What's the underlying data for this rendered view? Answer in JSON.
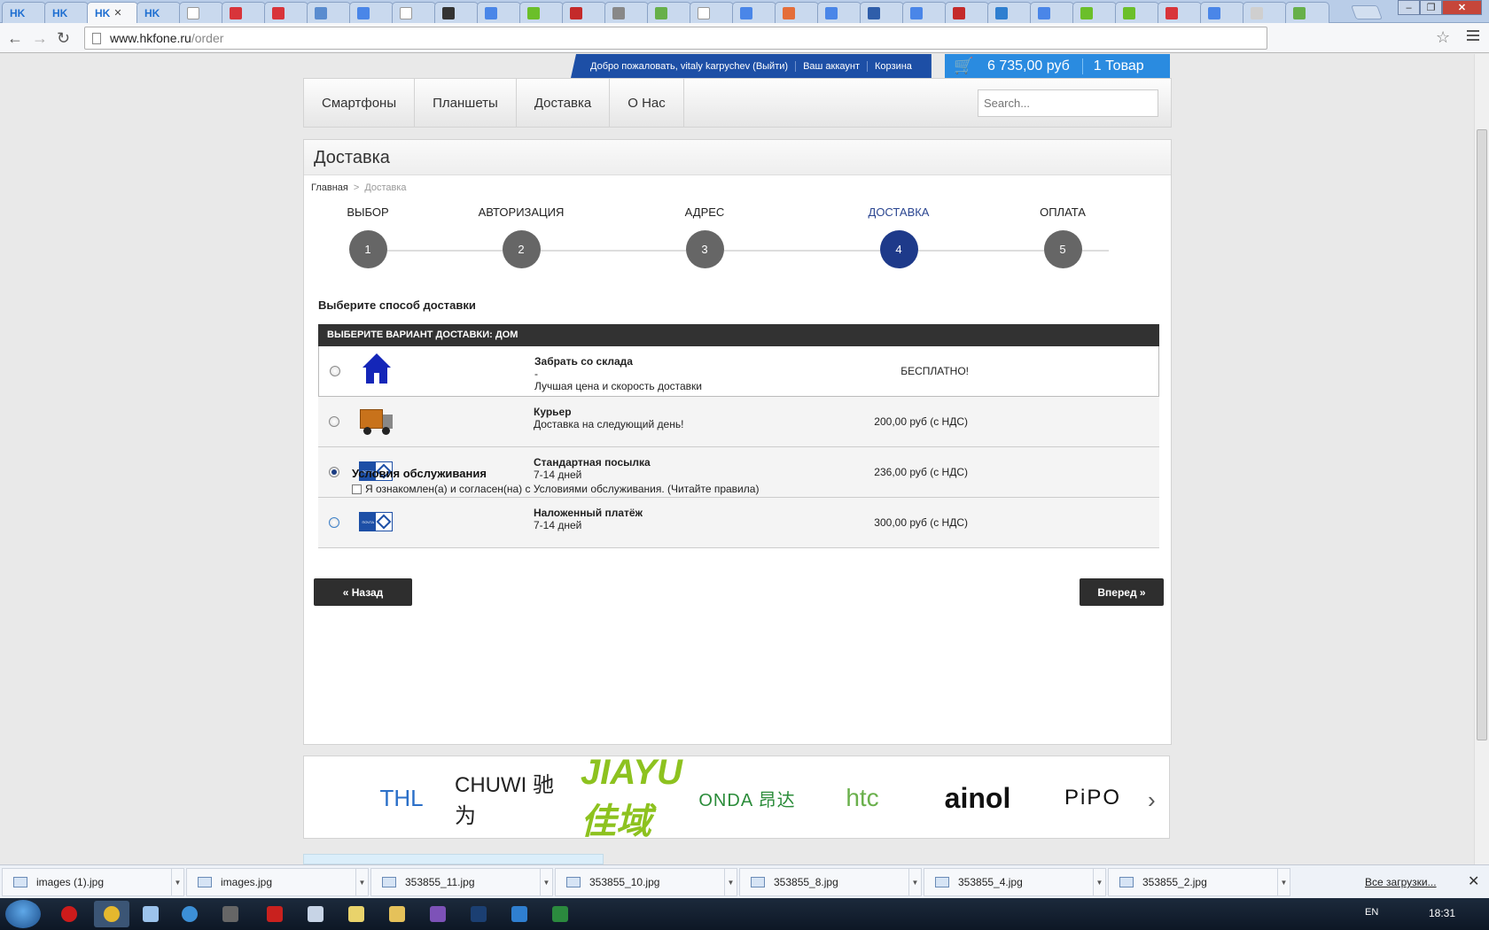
{
  "browser": {
    "tabs": [
      {
        "label": "HK",
        "active": false
      },
      {
        "label": "HK",
        "active": false
      },
      {
        "label": "HK",
        "active": true
      },
      {
        "label": "HK",
        "active": false
      }
    ],
    "url_host": "www.hkfone.ru",
    "url_path": "/order",
    "back_icon": "arrow-left",
    "forward_icon": "arrow-right",
    "reload_icon": "reload",
    "bookmark_icon": "star",
    "menu_icon": "hamburger"
  },
  "userbar": {
    "welcome": "Добро пожаловать, vitaly karpychev (Выйти)",
    "account": "Ваш аккаунт",
    "cart": "Корзина"
  },
  "cart": {
    "icon": "cart-icon",
    "total": "6 735,00 руб",
    "count": "1 Товар"
  },
  "nav": {
    "items": [
      "Смартфоны",
      "Планшеты",
      "Доставка",
      "О Нас"
    ],
    "search_placeholder": "Search..."
  },
  "page": {
    "title": "Доставка",
    "breadcrumb_home": "Главная",
    "breadcrumb_sep": ">",
    "breadcrumb_current": "Доставка"
  },
  "steps": [
    {
      "label": "ВЫБОР",
      "number": "1",
      "current": false
    },
    {
      "label": "АВТОРИЗАЦИЯ",
      "number": "2",
      "current": false
    },
    {
      "label": "АДРЕС",
      "number": "3",
      "current": false
    },
    {
      "label": "ДОСТАВКА",
      "number": "4",
      "current": true
    },
    {
      "label": "ОПЛАТА",
      "number": "5",
      "current": false
    }
  ],
  "delivery": {
    "heading": "Выберите способ доставки",
    "table_header": "ВЫБЕРИТЕ ВАРИАНТ ДОСТАВКИ: ДОМ",
    "options": [
      {
        "name": "Забрать со склада",
        "line2": "-",
        "line3": "Лучшая цена и скорость доставки",
        "price": "БЕСПЛАТНО!",
        "selected": false,
        "icon": "house-icon"
      },
      {
        "name": "Курьер",
        "line2": "Доставка на следующий день!",
        "line3": "",
        "price": "200,00 руб (с НДС)",
        "selected": false,
        "icon": "truck-icon"
      },
      {
        "name": "Стандартная посылка",
        "line2": "7-14 дней",
        "line3": "",
        "price": "236,00 руб (с НДС)",
        "selected": true,
        "icon": "russian-post-icon"
      },
      {
        "name": "Наложенный платёж",
        "line2": "7-14 дней",
        "line3": "",
        "price": "300,00 руб (с НДС)",
        "selected": false,
        "icon": "russian-post-icon"
      }
    ]
  },
  "tos": {
    "heading": "Условия обслуживания",
    "checkbox_label": "Я ознакомлен(а) и согласен(на) с Условиями обслуживания. (Читайте правила)",
    "checked": false
  },
  "buttons": {
    "back": "« Назад",
    "next": "Вперед »"
  },
  "brands": [
    "THL",
    "CHUWI 驰为",
    "JIAYU 佳域",
    "ONDA 昂达",
    "htc",
    "ainol",
    "PiPO"
  ],
  "downloads": {
    "files": [
      "images (1).jpg",
      "images.jpg",
      "353855_11.jpg",
      "353855_10.jpg",
      "353855_8.jpg",
      "353855_4.jpg",
      "353855_2.jpg"
    ],
    "show_all": "Все загрузки...",
    "close_icon": "close"
  },
  "taskbar": {
    "lang": "EN",
    "time": "18:31"
  }
}
